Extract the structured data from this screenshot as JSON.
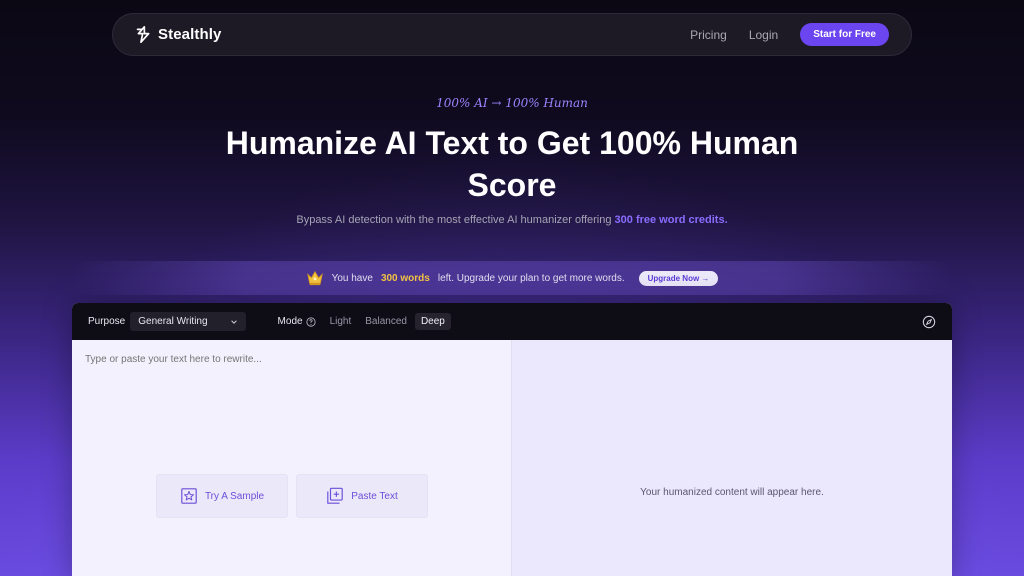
{
  "nav": {
    "brand": "Stealthly",
    "links": [
      "Pricing",
      "Login"
    ],
    "cta": "Start for Free"
  },
  "hero": {
    "tagline": "100% AI → 100% Human",
    "headline": "Humanize AI Text to Get 100% Human Score",
    "subtitle_prefix": "Bypass AI detection with the most effective AI humanizer offering",
    "subtitle_highlight": "300 free word credits."
  },
  "credits": {
    "prefix": "You have",
    "words": "300 words",
    "suffix": "left. Upgrade your plan to get more words.",
    "upgrade": "Upgrade Now →"
  },
  "toolbar": {
    "purpose_label": "Purpose",
    "purpose_value": "General Writing",
    "mode_label": "Mode",
    "modes": [
      "Light",
      "Balanced",
      "Deep"
    ],
    "active_mode": "Deep"
  },
  "editor": {
    "placeholder": "Type or paste your text here to rewrite...",
    "try_sample": "Try A Sample",
    "paste_text": "Paste Text",
    "output_message": "Your humanized content will appear here."
  },
  "colors": {
    "accent": "#6b45f0",
    "highlight": "#8b6cff",
    "gold": "#f5c542"
  }
}
